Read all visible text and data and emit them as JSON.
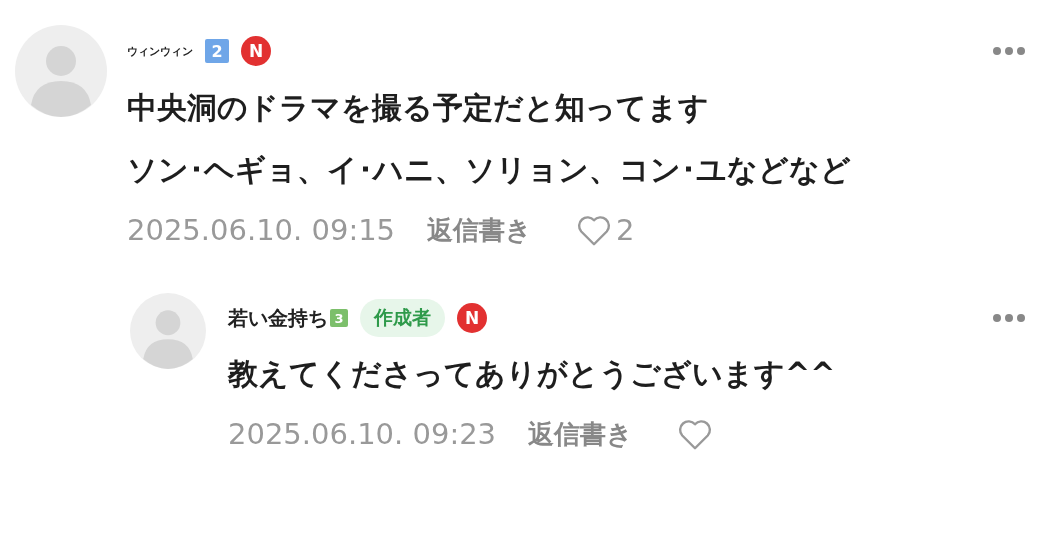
{
  "comments": [
    {
      "author": "ウィンウィン",
      "grade_badge": {
        "label": "2",
        "color": "#6fa6e8"
      },
      "new_badge": "N",
      "text": [
        "中央洞のドラマを撮る予定だと知ってます",
        "ソン･ヘギョ、イ･ハニ、ソリョン、コン･ユなどなど"
      ],
      "date": "2025.06.10. 09:15",
      "reply_label": "返信書き",
      "likes": "2",
      "replies": [
        {
          "author": "若い金持ち",
          "grade_badge": {
            "label": "3",
            "color": "#7cbf6b"
          },
          "author_badge": "作成者",
          "new_badge": "N",
          "text": [
            "教えてくださってありがとうございます^^"
          ],
          "date": "2025.06.10. 09:23",
          "reply_label": "返信書き"
        }
      ]
    }
  ]
}
